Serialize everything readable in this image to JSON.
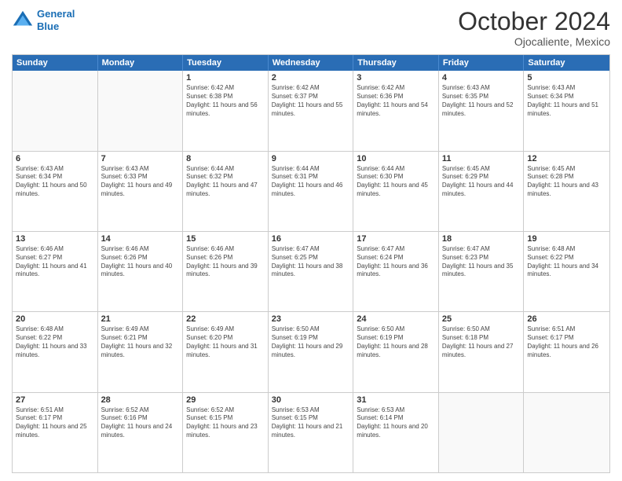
{
  "header": {
    "logo_line1": "General",
    "logo_line2": "Blue",
    "month": "October 2024",
    "location": "Ojocaliente, Mexico"
  },
  "weekdays": [
    "Sunday",
    "Monday",
    "Tuesday",
    "Wednesday",
    "Thursday",
    "Friday",
    "Saturday"
  ],
  "weeks": [
    [
      {
        "day": "",
        "info": ""
      },
      {
        "day": "",
        "info": ""
      },
      {
        "day": "1",
        "info": "Sunrise: 6:42 AM\nSunset: 6:38 PM\nDaylight: 11 hours and 56 minutes."
      },
      {
        "day": "2",
        "info": "Sunrise: 6:42 AM\nSunset: 6:37 PM\nDaylight: 11 hours and 55 minutes."
      },
      {
        "day": "3",
        "info": "Sunrise: 6:42 AM\nSunset: 6:36 PM\nDaylight: 11 hours and 54 minutes."
      },
      {
        "day": "4",
        "info": "Sunrise: 6:43 AM\nSunset: 6:35 PM\nDaylight: 11 hours and 52 minutes."
      },
      {
        "day": "5",
        "info": "Sunrise: 6:43 AM\nSunset: 6:34 PM\nDaylight: 11 hours and 51 minutes."
      }
    ],
    [
      {
        "day": "6",
        "info": "Sunrise: 6:43 AM\nSunset: 6:34 PM\nDaylight: 11 hours and 50 minutes."
      },
      {
        "day": "7",
        "info": "Sunrise: 6:43 AM\nSunset: 6:33 PM\nDaylight: 11 hours and 49 minutes."
      },
      {
        "day": "8",
        "info": "Sunrise: 6:44 AM\nSunset: 6:32 PM\nDaylight: 11 hours and 47 minutes."
      },
      {
        "day": "9",
        "info": "Sunrise: 6:44 AM\nSunset: 6:31 PM\nDaylight: 11 hours and 46 minutes."
      },
      {
        "day": "10",
        "info": "Sunrise: 6:44 AM\nSunset: 6:30 PM\nDaylight: 11 hours and 45 minutes."
      },
      {
        "day": "11",
        "info": "Sunrise: 6:45 AM\nSunset: 6:29 PM\nDaylight: 11 hours and 44 minutes."
      },
      {
        "day": "12",
        "info": "Sunrise: 6:45 AM\nSunset: 6:28 PM\nDaylight: 11 hours and 43 minutes."
      }
    ],
    [
      {
        "day": "13",
        "info": "Sunrise: 6:46 AM\nSunset: 6:27 PM\nDaylight: 11 hours and 41 minutes."
      },
      {
        "day": "14",
        "info": "Sunrise: 6:46 AM\nSunset: 6:26 PM\nDaylight: 11 hours and 40 minutes."
      },
      {
        "day": "15",
        "info": "Sunrise: 6:46 AM\nSunset: 6:26 PM\nDaylight: 11 hours and 39 minutes."
      },
      {
        "day": "16",
        "info": "Sunrise: 6:47 AM\nSunset: 6:25 PM\nDaylight: 11 hours and 38 minutes."
      },
      {
        "day": "17",
        "info": "Sunrise: 6:47 AM\nSunset: 6:24 PM\nDaylight: 11 hours and 36 minutes."
      },
      {
        "day": "18",
        "info": "Sunrise: 6:47 AM\nSunset: 6:23 PM\nDaylight: 11 hours and 35 minutes."
      },
      {
        "day": "19",
        "info": "Sunrise: 6:48 AM\nSunset: 6:22 PM\nDaylight: 11 hours and 34 minutes."
      }
    ],
    [
      {
        "day": "20",
        "info": "Sunrise: 6:48 AM\nSunset: 6:22 PM\nDaylight: 11 hours and 33 minutes."
      },
      {
        "day": "21",
        "info": "Sunrise: 6:49 AM\nSunset: 6:21 PM\nDaylight: 11 hours and 32 minutes."
      },
      {
        "day": "22",
        "info": "Sunrise: 6:49 AM\nSunset: 6:20 PM\nDaylight: 11 hours and 31 minutes."
      },
      {
        "day": "23",
        "info": "Sunrise: 6:50 AM\nSunset: 6:19 PM\nDaylight: 11 hours and 29 minutes."
      },
      {
        "day": "24",
        "info": "Sunrise: 6:50 AM\nSunset: 6:19 PM\nDaylight: 11 hours and 28 minutes."
      },
      {
        "day": "25",
        "info": "Sunrise: 6:50 AM\nSunset: 6:18 PM\nDaylight: 11 hours and 27 minutes."
      },
      {
        "day": "26",
        "info": "Sunrise: 6:51 AM\nSunset: 6:17 PM\nDaylight: 11 hours and 26 minutes."
      }
    ],
    [
      {
        "day": "27",
        "info": "Sunrise: 6:51 AM\nSunset: 6:17 PM\nDaylight: 11 hours and 25 minutes."
      },
      {
        "day": "28",
        "info": "Sunrise: 6:52 AM\nSunset: 6:16 PM\nDaylight: 11 hours and 24 minutes."
      },
      {
        "day": "29",
        "info": "Sunrise: 6:52 AM\nSunset: 6:15 PM\nDaylight: 11 hours and 23 minutes."
      },
      {
        "day": "30",
        "info": "Sunrise: 6:53 AM\nSunset: 6:15 PM\nDaylight: 11 hours and 21 minutes."
      },
      {
        "day": "31",
        "info": "Sunrise: 6:53 AM\nSunset: 6:14 PM\nDaylight: 11 hours and 20 minutes."
      },
      {
        "day": "",
        "info": ""
      },
      {
        "day": "",
        "info": ""
      }
    ]
  ]
}
